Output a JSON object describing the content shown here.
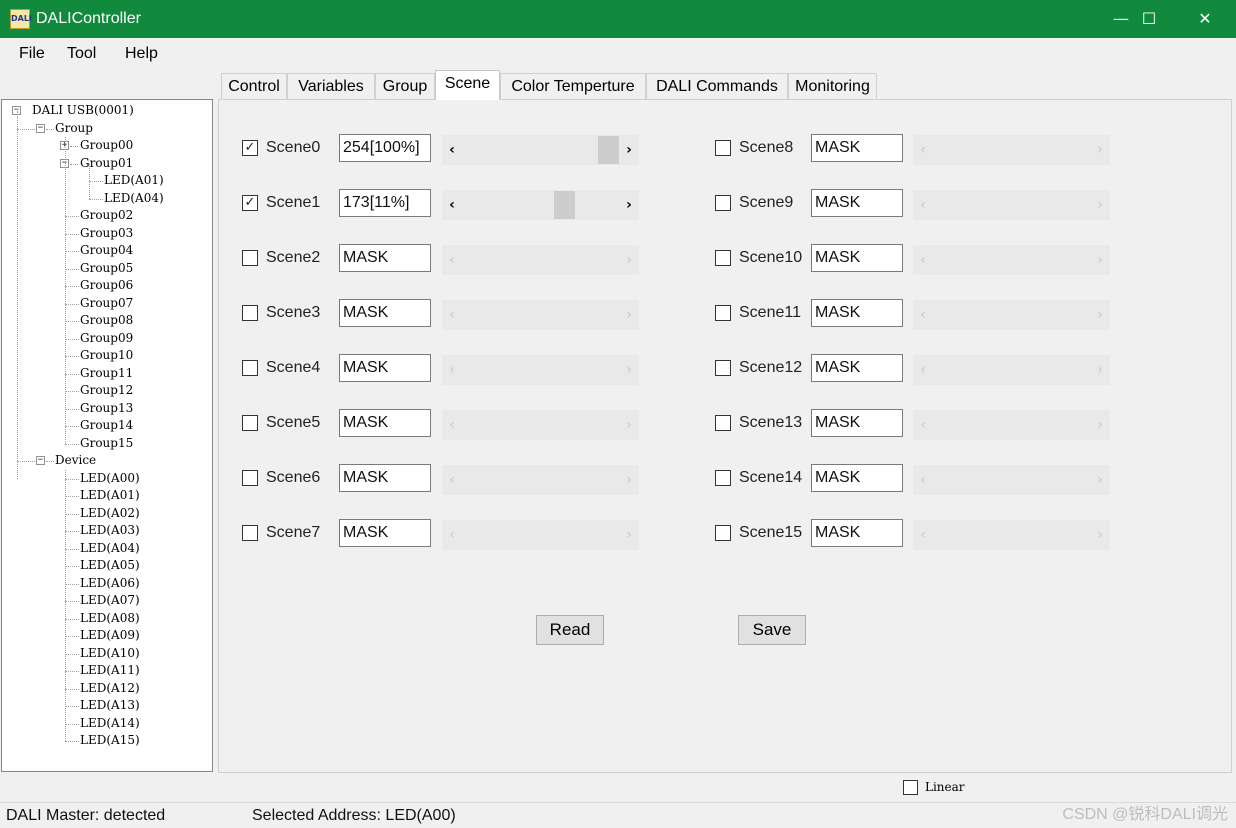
{
  "window": {
    "icon_text": "DALI",
    "title": "DALIController",
    "minimize_glyph": "—",
    "maximize_glyph": "☐",
    "close_glyph": "✕"
  },
  "menu": [
    "File",
    "Tool",
    "Help"
  ],
  "tabs": [
    "Control",
    "Variables",
    "Group",
    "Scene",
    "Color Temperture",
    "DALI Commands",
    "Monitoring"
  ],
  "active_tab": "Scene",
  "tree": {
    "root": "DALI USB(0001)",
    "group_label": "Group",
    "groups": [
      "Group00",
      "Group01",
      "Group02",
      "Group03",
      "Group04",
      "Group05",
      "Group06",
      "Group07",
      "Group08",
      "Group09",
      "Group10",
      "Group11",
      "Group12",
      "Group13",
      "Group14",
      "Group15"
    ],
    "group01_children": [
      "LED(A01)",
      "LED(A04)"
    ],
    "device_label": "Device",
    "devices": [
      "LED(A00)",
      "LED(A01)",
      "LED(A02)",
      "LED(A03)",
      "LED(A04)",
      "LED(A05)",
      "LED(A06)",
      "LED(A07)",
      "LED(A08)",
      "LED(A09)",
      "LED(A10)",
      "LED(A11)",
      "LED(A12)",
      "LED(A13)",
      "LED(A14)",
      "LED(A15)"
    ]
  },
  "scenes": [
    {
      "label": "Scene0",
      "checked": true,
      "value": "254[100%]",
      "level_fraction": 1.0
    },
    {
      "label": "Scene1",
      "checked": true,
      "value": "173[11%]",
      "level_fraction": 0.68
    },
    {
      "label": "Scene2",
      "checked": false,
      "value": "MASK"
    },
    {
      "label": "Scene3",
      "checked": false,
      "value": "MASK"
    },
    {
      "label": "Scene4",
      "checked": false,
      "value": "MASK"
    },
    {
      "label": "Scene5",
      "checked": false,
      "value": "MASK"
    },
    {
      "label": "Scene6",
      "checked": false,
      "value": "MASK"
    },
    {
      "label": "Scene7",
      "checked": false,
      "value": "MASK"
    },
    {
      "label": "Scene8",
      "checked": false,
      "value": "MASK"
    },
    {
      "label": "Scene9",
      "checked": false,
      "value": "MASK"
    },
    {
      "label": "Scene10",
      "checked": false,
      "value": "MASK"
    },
    {
      "label": "Scene11",
      "checked": false,
      "value": "MASK"
    },
    {
      "label": "Scene12",
      "checked": false,
      "value": "MASK"
    },
    {
      "label": "Scene13",
      "checked": false,
      "value": "MASK"
    },
    {
      "label": "Scene14",
      "checked": false,
      "value": "MASK"
    },
    {
      "label": "Scene15",
      "checked": false,
      "value": "MASK"
    }
  ],
  "buttons": {
    "read": "Read",
    "save": "Save"
  },
  "linear": {
    "label": "Linear",
    "checked": false
  },
  "status": {
    "master": "DALI Master: detected",
    "selected": "Selected Address: LED(A00)"
  },
  "watermark": "CSDN @锐科DALI调光",
  "colors": {
    "titlebar": "#118a3d",
    "window_bg": "#f0f0f0"
  }
}
